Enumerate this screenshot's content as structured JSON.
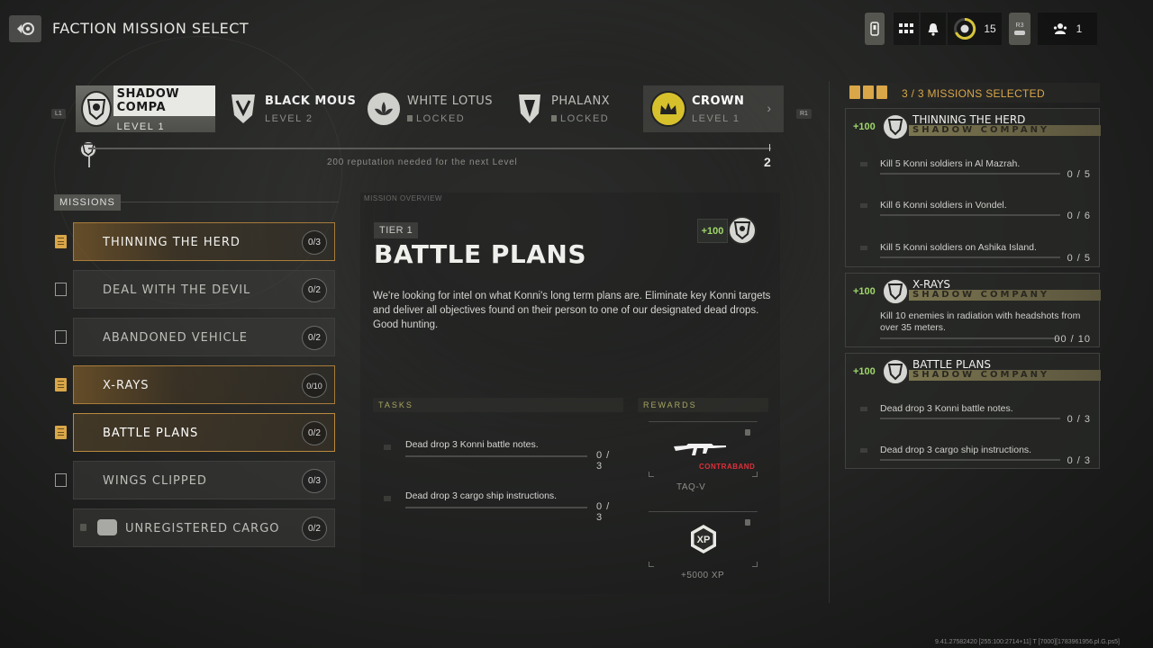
{
  "header": {
    "title": "FACTION MISSION SELECT",
    "currency_count": "15",
    "r3_label": "R3",
    "party_count": "1"
  },
  "bumpers": {
    "left": "L1",
    "right": "R1"
  },
  "factions": [
    {
      "name": "SHADOW COMPA",
      "status": "LEVEL 1",
      "locked": false,
      "selected": true
    },
    {
      "name": "BLACK MOUS",
      "status": "LEVEL 2",
      "locked": false,
      "selected": false
    },
    {
      "name": "WHITE LOTUS",
      "status": "LOCKED",
      "locked": true,
      "selected": false
    },
    {
      "name": "PHALANX",
      "status": "LOCKED",
      "locked": true,
      "selected": false
    },
    {
      "name": "CROWN",
      "status": "LEVEL 1",
      "locked": false,
      "selected": false
    }
  ],
  "reputation": {
    "text": "200 reputation needed for the next Level",
    "next_level": "2"
  },
  "missions": {
    "header": "MISSIONS",
    "items": [
      {
        "label": "THINNING THE HERD",
        "progress": "0/3",
        "state": "active"
      },
      {
        "label": "DEAL WITH THE DEVIL",
        "progress": "0/2",
        "state": "none"
      },
      {
        "label": "ABANDONED VEHICLE",
        "progress": "0/2",
        "state": "none"
      },
      {
        "label": "X-RAYS",
        "progress": "0/10",
        "state": "active"
      },
      {
        "label": "BATTLE PLANS",
        "progress": "0/2",
        "state": "selected"
      },
      {
        "label": "WINGS CLIPPED",
        "progress": "0/3",
        "state": "none"
      },
      {
        "label": "UNREGISTERED CARGO",
        "progress": "0/2",
        "state": "locked"
      }
    ]
  },
  "overview": {
    "section_label": "MISSION OVERVIEW",
    "tier": "TIER 1",
    "title": "BATTLE PLANS",
    "rep_reward": "+100",
    "description": "We're looking for intel on what Konni's long term plans are. Eliminate key Konni targets and deliver all objectives found on their person to one of our designated dead drops. Good hunting.",
    "tasks_label": "TASKS",
    "rewards_label": "REWARDS",
    "tasks": [
      {
        "text": "Dead drop 3 Konni battle notes.",
        "progress": "0 / 3"
      },
      {
        "text": "Dead drop 3 cargo ship instructions.",
        "progress": "0 / 3"
      }
    ],
    "rewards": [
      {
        "label": "TAQ-V",
        "tag": "CONTRABAND",
        "icon": "rifle-icon"
      },
      {
        "label": "+5000 XP",
        "tag": "",
        "icon": "xp-icon"
      }
    ]
  },
  "selected_panel": {
    "count_label": "3 / 3 MISSIONS SELECTED",
    "faction_label": "SHADOW COMPANY",
    "cards": [
      {
        "rep": "+100",
        "title": "THINNING THE HERD",
        "tasks": [
          {
            "text": "Kill 5 Konni soldiers in Al Mazrah.",
            "progress": "0 / 5"
          },
          {
            "text": "Kill 6 Konni soldiers in Vondel.",
            "progress": "0 / 6"
          },
          {
            "text": "Kill 5 Konni soldiers on Ashika Island.",
            "progress": "0 / 5"
          }
        ]
      },
      {
        "rep": "+100",
        "title": "X-RAYS",
        "tasks": [
          {
            "text": "Kill 10 enemies in radiation with headshots from over 35 meters.",
            "progress": "00 / 10"
          }
        ]
      },
      {
        "rep": "+100",
        "title": "BATTLE PLANS",
        "tasks": [
          {
            "text": "Dead drop 3 Konni battle notes.",
            "progress": "0 / 3"
          },
          {
            "text": "Dead drop 3 cargo ship instructions.",
            "progress": "0 / 3"
          }
        ]
      }
    ]
  },
  "build_string": "9.41.27582420 [255:100:2714+11] T [7000][1783961956.pl.G.ps5]",
  "colors": {
    "accent_orange": "#d9a648",
    "rep_green": "#9fd66a",
    "contraband_red": "#e0303a"
  }
}
